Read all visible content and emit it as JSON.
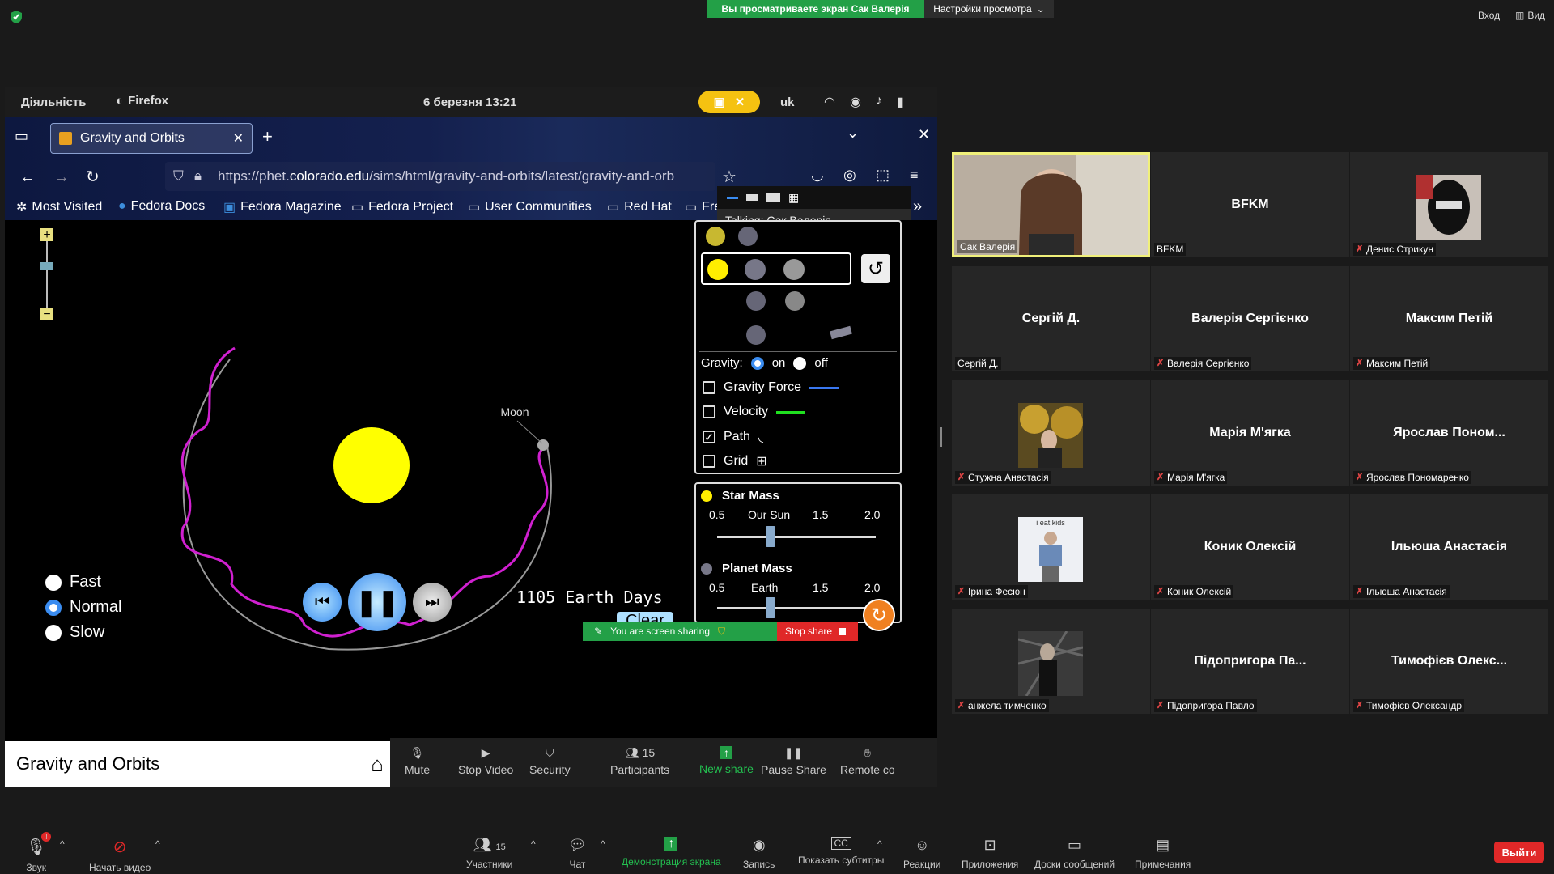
{
  "zoom": {
    "share_banner": "Вы просматриваете экран Сак Валерія",
    "view_options": "Настройки просмотра",
    "login": "Вход",
    "view": "Вид",
    "bottom_bar": [
      {
        "label": "Звук",
        "icon": "microphone-muted-icon"
      },
      {
        "label": "Начать видео",
        "icon": "video-off-icon"
      },
      {
        "label": "Участники",
        "count": "15",
        "icon": "participants-icon"
      },
      {
        "label": "Чат",
        "icon": "chat-icon"
      },
      {
        "label": "Демонстрация экрана",
        "icon": "share-screen-icon",
        "accent": "#23a047"
      },
      {
        "label": "Запись",
        "icon": "record-icon"
      },
      {
        "label": "Показать субтитры",
        "icon": "cc-icon"
      },
      {
        "label": "Реакции",
        "icon": "reactions-icon"
      },
      {
        "label": "Приложения",
        "icon": "apps-icon"
      },
      {
        "label": "Доски сообщений",
        "icon": "whiteboard-icon"
      },
      {
        "label": "Примечания",
        "icon": "notes-icon"
      }
    ],
    "leave_label": "Выйти",
    "leave_color": "#e02828"
  },
  "shared": {
    "gnome": {
      "activities": "Діяльність",
      "app": "Firefox",
      "datetime": "6 березня  13:21",
      "lang": "uk"
    },
    "firefox": {
      "tab_title": "Gravity and Orbits",
      "url_prefix": "https://phet.",
      "url_domain": "colorado.edu",
      "url_rest": "/sims/html/gravity-and-orbits/latest/gravity-and-orb",
      "bookmarks": [
        "Most Visited",
        "Fedora Docs",
        "Fedora Magazine",
        "Fedora Project",
        "User Communities",
        "Red Hat",
        "Fre"
      ]
    },
    "talking": "Talking: Сак Валерія",
    "sim": {
      "moon_label": "Moon",
      "gravity_label": "Gravity:",
      "gravity_on": "on",
      "gravity_off": "off",
      "checkboxes": [
        {
          "label": "Gravity Force",
          "checked": false
        },
        {
          "label": "Velocity",
          "checked": false
        },
        {
          "label": "Path",
          "checked": true
        },
        {
          "label": "Grid",
          "checked": false
        }
      ],
      "star_mass": {
        "title": "Star Mass",
        "ticks": [
          "0.5",
          "Our Sun",
          "1.5",
          "2.0"
        ],
        "value": 1.0
      },
      "planet_mass": {
        "title": "Planet Mass",
        "ticks": [
          "0.5",
          "Earth",
          "1.5",
          "2.0"
        ],
        "value": 1.0
      },
      "speeds": [
        "Fast",
        "Normal",
        "Slow"
      ],
      "selected_speed": "Normal",
      "days": "1105 Earth Days",
      "clear": "Clear",
      "title": "Gravity and Orbits"
    },
    "sharing_bar": {
      "status": "You are screen sharing",
      "stop": "Stop share"
    },
    "zoom_toolbar": [
      {
        "label": "Mute",
        "icon": "microphone-icon"
      },
      {
        "label": "Stop Video",
        "icon": "video-icon"
      },
      {
        "label": "Security",
        "icon": "shield-icon"
      },
      {
        "label": "Participants",
        "count": "15",
        "icon": "participants-icon"
      },
      {
        "label": "New share",
        "icon": "share-icon",
        "accent": "#23a047"
      },
      {
        "label": "Pause Share",
        "icon": "pause-icon"
      },
      {
        "label": "Remote co",
        "icon": "remote-icon"
      }
    ]
  },
  "participants": [
    {
      "name": "Сак Валерія",
      "display": "",
      "video": true,
      "active": true,
      "muted": false
    },
    {
      "name": "BFKM",
      "display": "BFKM",
      "video": false,
      "muted": false
    },
    {
      "name": "Денис Стрикун",
      "display": "",
      "video": true,
      "muted": true
    },
    {
      "name": "Сергій Д.",
      "display": "Сергій Д.",
      "video": false,
      "muted": false
    },
    {
      "name": "Валерія Сергієнко",
      "display": "Валерія Сергієнко",
      "video": false,
      "muted": true
    },
    {
      "name": "Максим Петій",
      "display": "Максим Петій",
      "video": false,
      "muted": true
    },
    {
      "name": "Стужна Анастасія",
      "display": "",
      "video": true,
      "muted": true
    },
    {
      "name": "Марія М'ягка",
      "display": "Марія М'ягка",
      "video": false,
      "muted": true
    },
    {
      "name": "Ярослав Пономаренко",
      "display": "Ярослав  Поном...",
      "video": false,
      "muted": true
    },
    {
      "name": "Ірина Фесюн",
      "display": "",
      "video": true,
      "muted": true,
      "thumb_text": "i eat kids"
    },
    {
      "name": "Коник Олексій",
      "display": "Коник Олексій",
      "video": false,
      "muted": true
    },
    {
      "name": "Ільюша Анастасія",
      "display": "Ільюша Анастасія",
      "video": false,
      "muted": true
    },
    {
      "name": "анжела тимченко",
      "display": "",
      "video": true,
      "muted": true
    },
    {
      "name": "Підопригора Павло",
      "display": "Підопригора Па...",
      "video": false,
      "muted": true
    },
    {
      "name": "Тимофієв Олександр",
      "display": "Тимофієв Олекс...",
      "video": false,
      "muted": true
    }
  ]
}
